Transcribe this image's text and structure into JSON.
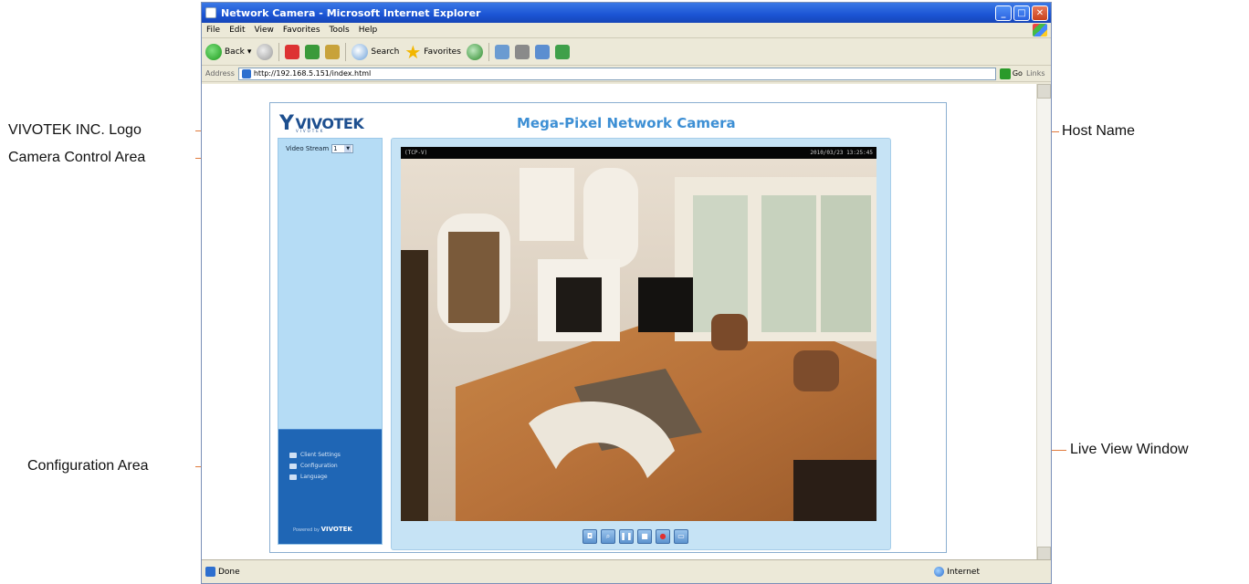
{
  "callouts": {
    "logo": "VIVOTEK INC. Logo",
    "camera_control": "Camera Control Area",
    "configuration": "Configuration Area",
    "host_name": "Host Name",
    "live_view": "Live View Window"
  },
  "browser": {
    "title": "Network Camera - Microsoft Internet Explorer",
    "menu": [
      "File",
      "Edit",
      "View",
      "Favorites",
      "Tools",
      "Help"
    ],
    "toolbar": {
      "back": "Back",
      "search": "Search",
      "favorites": "Favorites"
    },
    "address_label": "Address",
    "address_url": "http://192.168.5.151/index.html",
    "go_label": "Go",
    "links_label": "Links",
    "status": "Done",
    "zone": "Internet"
  },
  "camera_page": {
    "logo_text": "VIVOTEK",
    "logo_subtext": "VIVOTEK",
    "host_name": "Mega-Pixel Network Camera",
    "video_stream_label": "Video Stream",
    "video_stream_value": "1",
    "config_items": [
      {
        "label": "Client Settings",
        "icon": "monitor-icon"
      },
      {
        "label": "Configuration",
        "icon": "wrench-icon"
      },
      {
        "label": "Language",
        "icon": "globe-icon"
      }
    ],
    "powered_by": "Powered by",
    "powered_brand": "VIVOTEK",
    "live_caption_left": "(TCP-V)",
    "live_timestamp": "2010/03/23 13:25:45",
    "controls": [
      {
        "name": "snapshot-button",
        "glyph": "◘"
      },
      {
        "name": "digital-zoom-button",
        "glyph": "⌕"
      },
      {
        "name": "pause-button",
        "glyph": "❚❚"
      },
      {
        "name": "stop-button",
        "glyph": "■"
      },
      {
        "name": "record-button",
        "glyph": "●"
      },
      {
        "name": "fullscreen-button",
        "glyph": "▭"
      }
    ]
  },
  "colors": {
    "accent_blue": "#3d8fd4",
    "panel_blue": "#b5dcf5",
    "config_blue": "#1f66b5",
    "callout_line": "#e07a3c"
  }
}
